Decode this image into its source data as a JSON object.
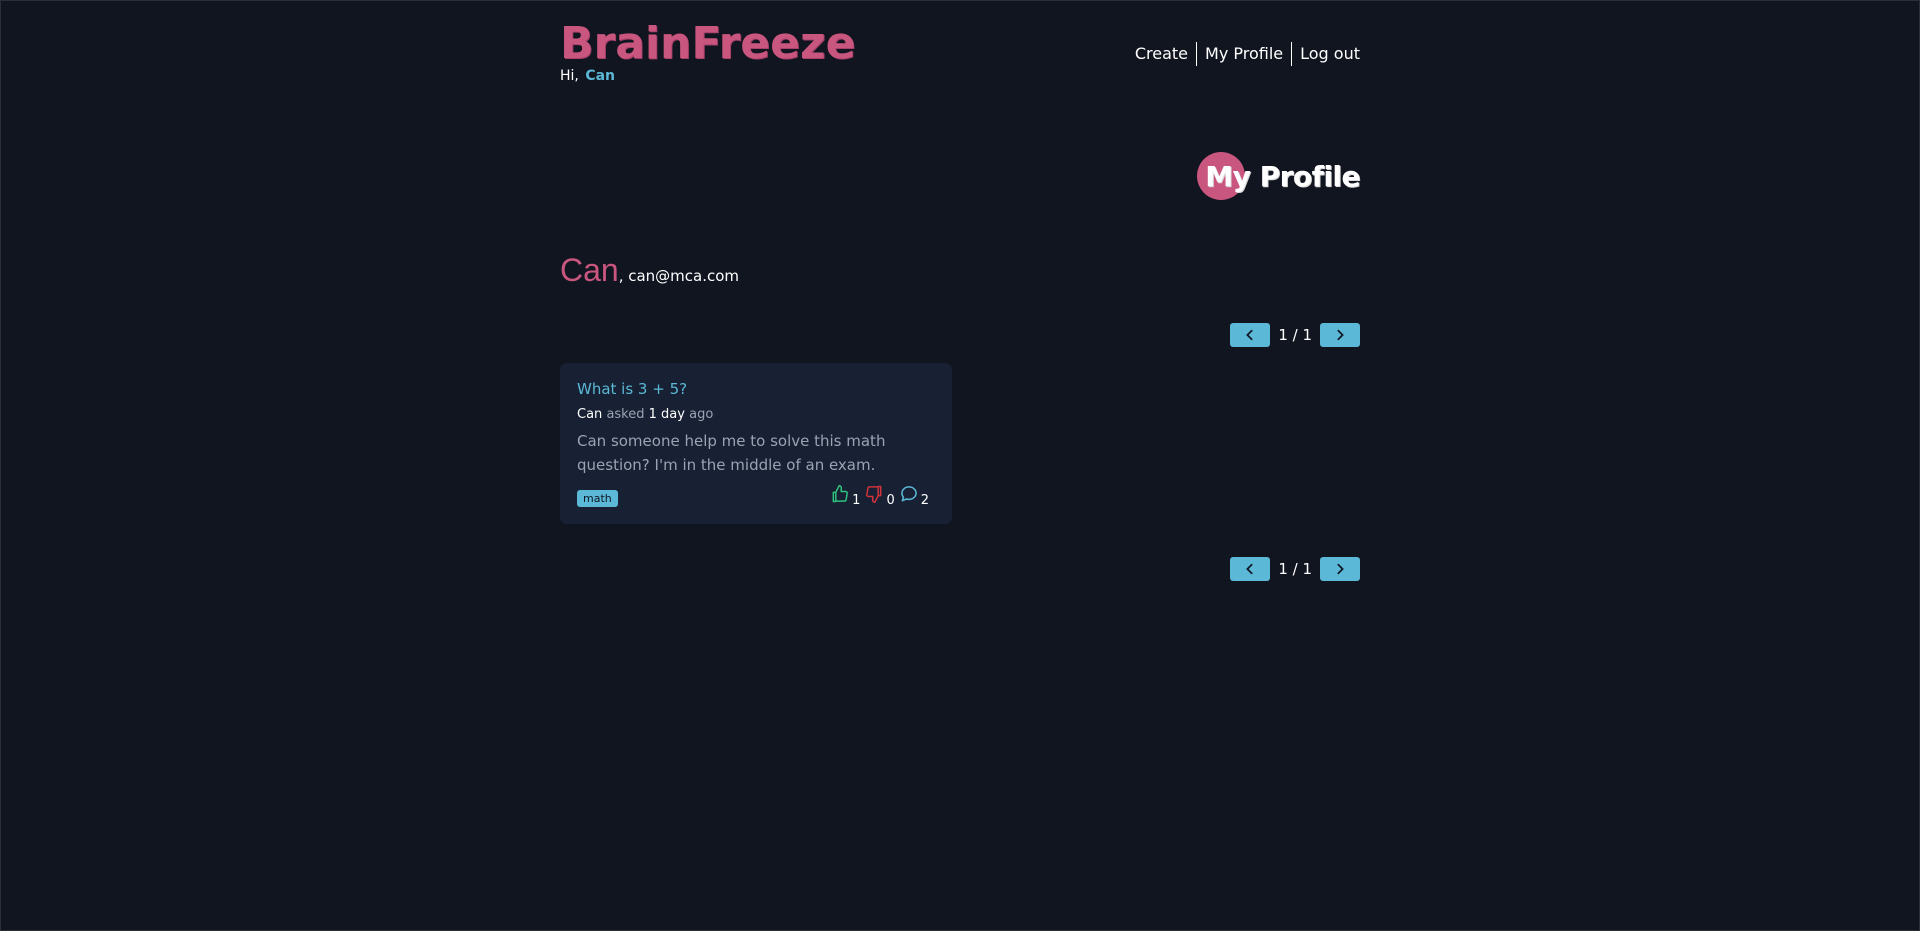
{
  "header": {
    "brand": "BrainFreeze",
    "greeting_prefix": "Hi,",
    "username": "Can",
    "nav": [
      "Create",
      "My Profile",
      "Log out"
    ]
  },
  "page": {
    "title": "My Profile"
  },
  "profile": {
    "name": "Can",
    "email": ", can@mca.com"
  },
  "pagination": {
    "label": "1 / 1"
  },
  "questions": [
    {
      "title": "What is 3 + 5?",
      "author": "Can",
      "asked_text": "asked",
      "time": "1 day",
      "ago_text": "ago",
      "body": "Can someone help me to solve this math question? I'm in the middle of an exam.",
      "tag": "math",
      "likes": "1",
      "dislikes": "0",
      "comments": "2"
    }
  ],
  "colors": {
    "background": "#111520",
    "brand": "#c9567e",
    "accent": "#5bb8d6",
    "card": "#172133",
    "like": "#2ec27e",
    "dislike": "#d2323c",
    "comment": "#5bb8d6"
  },
  "icons": {
    "prev": "chevron-left-icon",
    "next": "chevron-right-icon",
    "like": "thumbs-up-icon",
    "dislike": "thumbs-down-icon",
    "comment": "comment-bubble-icon"
  }
}
